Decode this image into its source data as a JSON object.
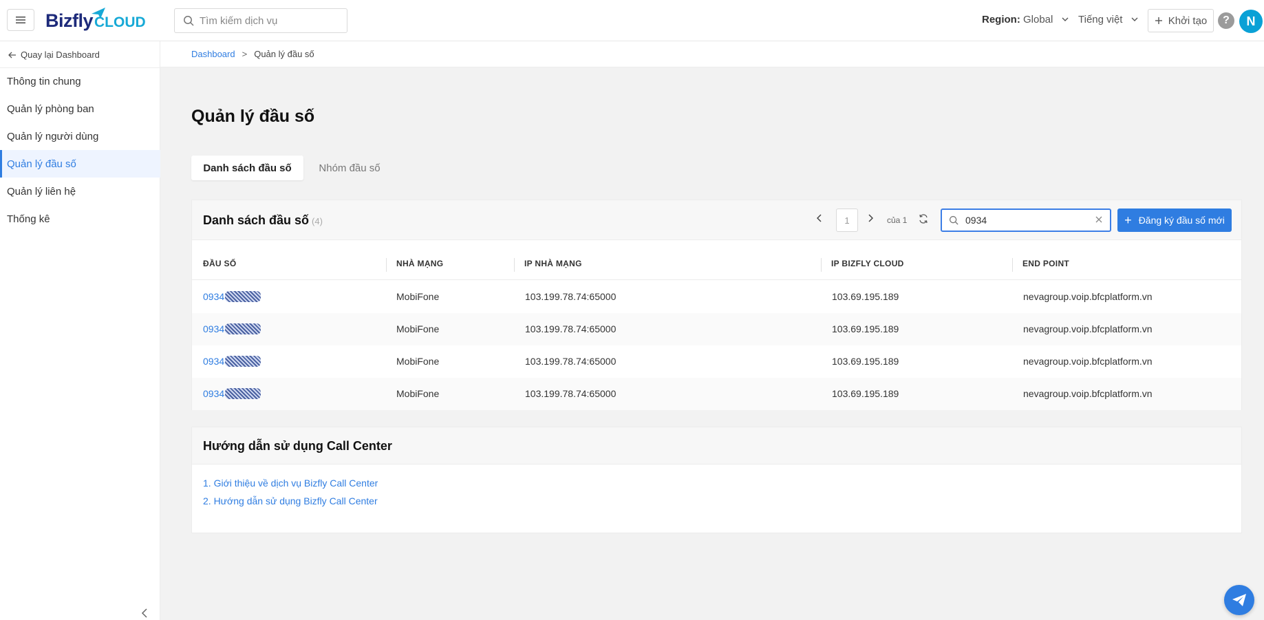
{
  "header": {
    "logo_main": "Bizfly",
    "logo_sub": "CLOUD",
    "search_placeholder": "Tìm kiếm dịch vụ",
    "region_label": "Region:",
    "region_value": "Global",
    "language": "Tiếng việt",
    "create_label": "Khởi tạo",
    "help": "?",
    "avatar_initial": "N"
  },
  "sidebar": {
    "back_label": "Quay lại Dashboard",
    "items": [
      {
        "label": "Thông tin chung",
        "active": false
      },
      {
        "label": "Quản lý phòng ban",
        "active": false
      },
      {
        "label": "Quản lý người dùng",
        "active": false
      },
      {
        "label": "Quản lý đầu số",
        "active": true
      },
      {
        "label": "Quản lý liên hệ",
        "active": false
      },
      {
        "label": "Thống kê",
        "active": false
      }
    ]
  },
  "breadcrumb": {
    "home": "Dashboard",
    "separator": ">",
    "current": "Quản lý đầu số"
  },
  "page": {
    "title": "Quản lý đầu số",
    "tabs": [
      {
        "label": "Danh sách đầu số",
        "active": true
      },
      {
        "label": "Nhóm đầu số",
        "active": false
      }
    ]
  },
  "list": {
    "title": "Danh sách đầu số",
    "count": "(4)",
    "page": "1",
    "of_label": "của 1",
    "search_value": "0934",
    "register_label": "Đăng ký đầu số mới",
    "columns": [
      "ĐẦU SỐ",
      "NHÀ MẠNG",
      "IP NHÀ MẠNG",
      "IP BIZFLY CLOUD",
      "END POINT"
    ],
    "rows": [
      {
        "number": "0934",
        "carrier": "MobiFone",
        "carrier_ip": "103.199.78.74:65000",
        "bizfly_ip": "103.69.195.189",
        "endpoint": "nevagroup.voip.bfcplatform.vn"
      },
      {
        "number": "0934",
        "carrier": "MobiFone",
        "carrier_ip": "103.199.78.74:65000",
        "bizfly_ip": "103.69.195.189",
        "endpoint": "nevagroup.voip.bfcplatform.vn"
      },
      {
        "number": "0934",
        "carrier": "MobiFone",
        "carrier_ip": "103.199.78.74:65000",
        "bizfly_ip": "103.69.195.189",
        "endpoint": "nevagroup.voip.bfcplatform.vn"
      },
      {
        "number": "0934",
        "carrier": "MobiFone",
        "carrier_ip": "103.199.78.74:65000",
        "bizfly_ip": "103.69.195.189",
        "endpoint": "nevagroup.voip.bfcplatform.vn"
      }
    ]
  },
  "guide": {
    "title": "Hướng dẫn sử dụng Call Center",
    "links": [
      "1. Giới thiệu về dịch vụ Bizfly Call Center",
      "2. Hướng dẫn sử dụng Bizfly Call Center"
    ]
  },
  "colors": {
    "accent": "#2f7de1",
    "brand_dark": "#1d2a7a",
    "brand_light": "#17a9d6"
  }
}
